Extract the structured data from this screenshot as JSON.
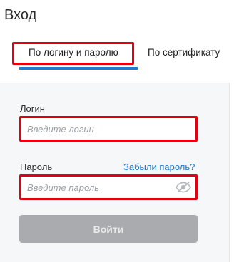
{
  "header": {
    "title": "Вход"
  },
  "tabs": [
    {
      "label": "По логину и паролю",
      "active": true
    },
    {
      "label": "По сертификату",
      "active": false
    }
  ],
  "form": {
    "login": {
      "label": "Логин",
      "placeholder": "Введите логин",
      "value": ""
    },
    "password": {
      "label": "Пароль",
      "placeholder": "Введите пароль",
      "value": "",
      "toggle_icon": "eye-slash-icon"
    },
    "forgot_link": "Забыли пароль?",
    "submit_label": "Войти"
  },
  "colors": {
    "accent": "#1f7ad1",
    "highlight": "#e4000f",
    "disabled_button": "#a9abae"
  }
}
